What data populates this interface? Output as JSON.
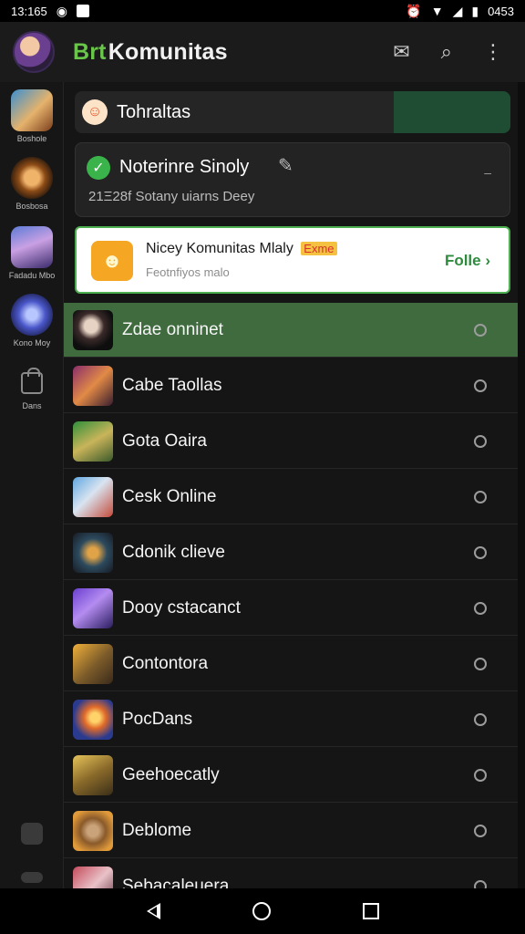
{
  "status_bar": {
    "time": "13:165",
    "battery": "0453"
  },
  "app_bar": {
    "brand_accent": "Brt",
    "brand_title": "Komunitas",
    "icons": [
      "avatar",
      "mail-icon",
      "search-icon",
      "more-vert-icon"
    ]
  },
  "rail": {
    "items": [
      {
        "label": "Boshole"
      },
      {
        "label": "Bosbosa"
      },
      {
        "label": "Fadadu Mbo"
      },
      {
        "label": "Kono Moy"
      },
      {
        "label": "Dans"
      }
    ]
  },
  "cards": {
    "top": {
      "label": "Tohraltas"
    },
    "notification": {
      "title": "Noterinre Sinoly",
      "subtitle": "21Ξ28f Sotany uiarns Deey"
    },
    "promo": {
      "title": "Nicey Komunitas Mlaly",
      "tag": "Exme",
      "subtitle": "Feotnfiyos malo",
      "action": "Folle"
    }
  },
  "list": [
    {
      "label": "Zdae onninet",
      "active": true
    },
    {
      "label": "Cabe Taollas",
      "active": false
    },
    {
      "label": "Gota Oaira",
      "active": false
    },
    {
      "label": "Cesk Online",
      "active": false
    },
    {
      "label": "Cdonik clieve",
      "active": false
    },
    {
      "label": "Dooy cstacanct",
      "active": false
    },
    {
      "label": "Contontora",
      "active": false
    },
    {
      "label": "PocDans",
      "active": false
    },
    {
      "label": "Geehoecatly",
      "active": false
    },
    {
      "label": "Deblome",
      "active": false
    },
    {
      "label": "Sebacaleuera",
      "active": false
    }
  ],
  "colors": {
    "accent_green": "#69c64b",
    "active_row": "#3f6b3f",
    "promo_border": "#4caf50",
    "background": "#151515"
  }
}
